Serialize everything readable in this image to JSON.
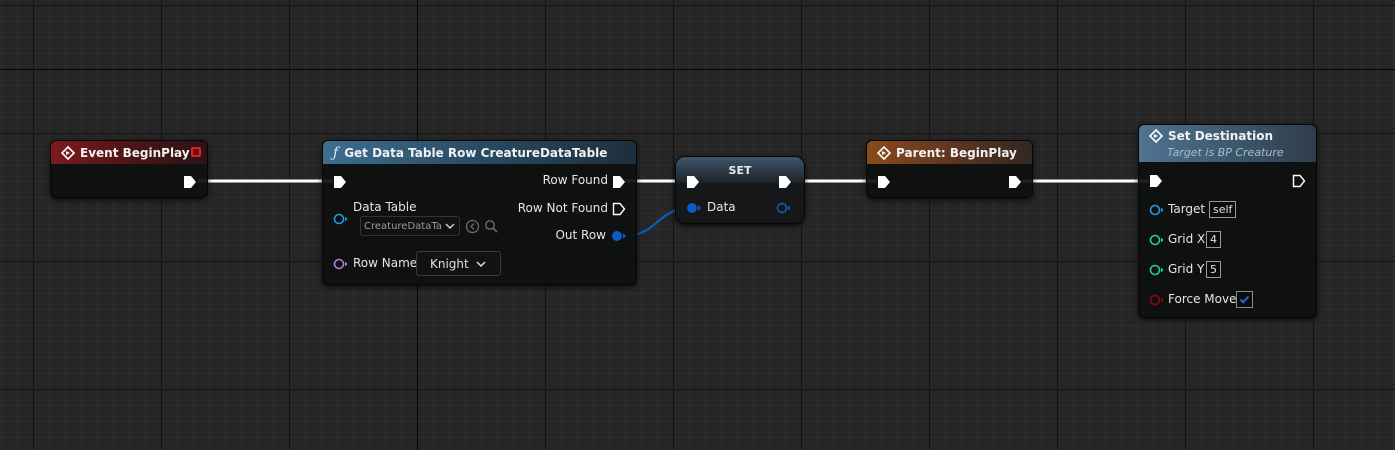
{
  "graph": {
    "nodes": {
      "event_begin_play": {
        "title": "Event BeginPlay",
        "header_color": "#7b1a1f"
      },
      "get_data_table_row": {
        "title": "Get Data Table Row CreatureDataTable",
        "header_color": "#3c6e8f",
        "outputs": {
          "row_found": "Row Found",
          "row_not_found": "Row Not Found",
          "out_row": "Out Row"
        },
        "inputs": {
          "data_table_label": "Data Table",
          "data_table_value": "CreatureDataTa",
          "row_name_label": "Row Name",
          "row_name_value": "Knight"
        }
      },
      "set": {
        "title": "SET",
        "data_label": "Data"
      },
      "parent_begin_play": {
        "title": "Parent: BeginPlay",
        "header_color": "#8a4a1c"
      },
      "set_destination": {
        "title": "Set Destination",
        "subtitle": "Target is BP Creature",
        "header_color": "#4f7391",
        "inputs": {
          "target_label": "Target",
          "target_value": "self",
          "grid_x_label": "Grid X",
          "grid_x_value": "4",
          "grid_y_label": "Grid Y",
          "grid_y_value": "5",
          "force_move_label": "Force Move",
          "force_move_checked": true
        }
      }
    },
    "colors": {
      "exec_wire": "#ffffff",
      "struct_pin": "#0a5cc8",
      "object_pin": "#1f9bd6",
      "name_pin": "#b57ad6",
      "integer_pin": "#1fcf9a",
      "bool_pin": "#8a0a0a",
      "checkbox_check": "#1f6ad9"
    }
  }
}
